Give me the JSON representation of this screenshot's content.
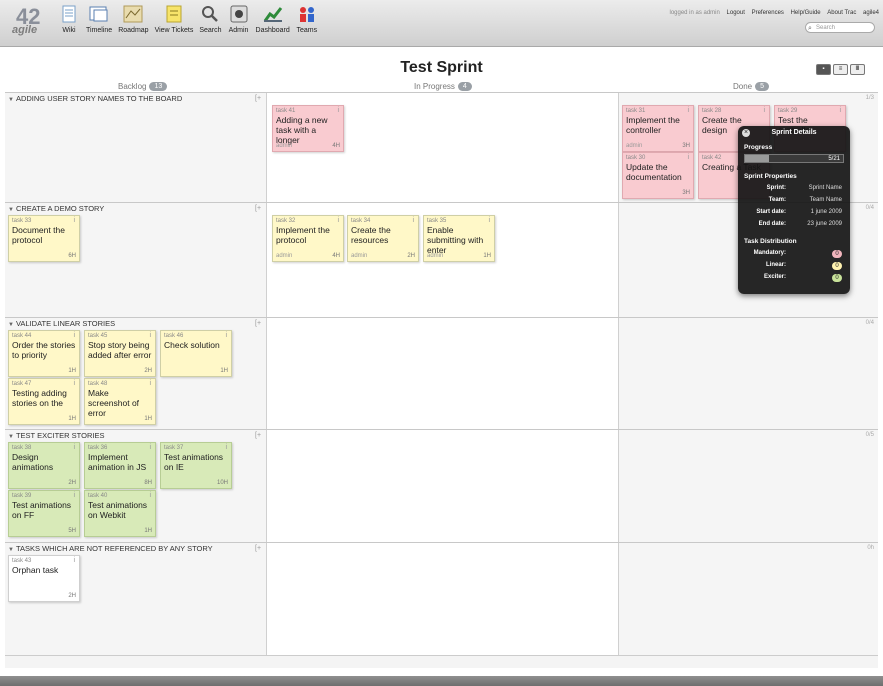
{
  "app": {
    "logo_number": "42",
    "logo_text": "agile"
  },
  "nav": [
    {
      "label": "Wiki",
      "icon": "wiki-icon"
    },
    {
      "label": "Timeline",
      "icon": "timeline-icon"
    },
    {
      "label": "Roadmap",
      "icon": "roadmap-icon"
    },
    {
      "label": "View Tickets",
      "icon": "tickets-icon"
    },
    {
      "label": "Search",
      "icon": "search-icon"
    },
    {
      "label": "Admin",
      "icon": "admin-icon"
    },
    {
      "label": "Dashboard",
      "icon": "dashboard-icon"
    },
    {
      "label": "Teams",
      "icon": "teams-icon"
    }
  ],
  "metanav": {
    "logged_in": "logged in as admin",
    "logout": "Logout",
    "preferences": "Preferences",
    "help": "Help/Guide",
    "about": "About Trac",
    "extra": "agile4"
  },
  "search": {
    "placeholder": "Search"
  },
  "sprint": {
    "title": "Test Sprint"
  },
  "columns": [
    {
      "name": "Backlog",
      "count": "13"
    },
    {
      "name": "In Progress",
      "count": "4"
    },
    {
      "name": "Done",
      "count": "5"
    }
  ],
  "rows": [
    {
      "title": "ADDING USER STORY NAMES TO THE BOARD",
      "count": "1/3",
      "cards": [
        {
          "id": "task 41",
          "title": "Adding a new task with a longer",
          "owner": "admin",
          "est": "4H",
          "color": "pink"
        },
        {
          "id": "task 31",
          "title": "Implement the controller",
          "owner": "admin",
          "est": "3H",
          "color": "pink"
        },
        {
          "id": "task 28",
          "title": "Create the design",
          "owner": "",
          "est": "",
          "color": "pink"
        },
        {
          "id": "task 29",
          "title": "Test the controller",
          "owner": "",
          "est": "",
          "color": "pink"
        },
        {
          "id": "task 30",
          "title": "Update the documentation",
          "owner": "",
          "est": "3H",
          "color": "pink"
        },
        {
          "id": "task 42",
          "title": "Creating a Task",
          "owner": "",
          "est": "",
          "color": "pink"
        }
      ]
    },
    {
      "title": "CREATE A DEMO STORY",
      "count": "0/4",
      "cards": [
        {
          "id": "task 33",
          "title": "Document the protocol",
          "owner": "",
          "est": "6H",
          "color": "yellow"
        },
        {
          "id": "task 32",
          "title": "Implement the protocol",
          "owner": "admin",
          "est": "4H",
          "color": "yellow"
        },
        {
          "id": "task 34",
          "title": "Create the resources",
          "owner": "admin",
          "est": "2H",
          "color": "yellow"
        },
        {
          "id": "task 35",
          "title": "Enable submitting with enter",
          "owner": "admin",
          "est": "1H",
          "color": "yellow"
        }
      ]
    },
    {
      "title": "VALIDATE LINEAR STORIES",
      "count": "0/4",
      "cards": [
        {
          "id": "task 44",
          "title": "Order the stories to priority",
          "owner": "",
          "est": "1H",
          "color": "yellow"
        },
        {
          "id": "task 45",
          "title": "Stop story being added after error",
          "owner": "",
          "est": "2H",
          "color": "yellow"
        },
        {
          "id": "task 46",
          "title": "Check solution",
          "owner": "",
          "est": "1H",
          "color": "yellow"
        },
        {
          "id": "task 47",
          "title": "Testing adding stories on the",
          "owner": "",
          "est": "1H",
          "color": "yellow"
        },
        {
          "id": "task 48",
          "title": "Make screenshot of error",
          "owner": "",
          "est": "1H",
          "color": "yellow"
        }
      ]
    },
    {
      "title": "TEST EXCITER STORIES",
      "count": "0/5",
      "cards": [
        {
          "id": "task 38",
          "title": "Design animations",
          "owner": "",
          "est": "2H",
          "color": "green"
        },
        {
          "id": "task 36",
          "title": "Implement animation in JS",
          "owner": "",
          "est": "8H",
          "color": "green"
        },
        {
          "id": "task 37",
          "title": "Test animations on IE",
          "owner": "",
          "est": "10H",
          "color": "green"
        },
        {
          "id": "task 39",
          "title": "Test animations on FF",
          "owner": "",
          "est": "5H",
          "color": "green"
        },
        {
          "id": "task 40",
          "title": "Test animations on Webkit",
          "owner": "",
          "est": "1H",
          "color": "green"
        }
      ]
    },
    {
      "title": "TASKS WHICH ARE NOT REFERENCED BY ANY STORY",
      "count": "0h",
      "cards": [
        {
          "id": "task 43",
          "title": "Orphan task",
          "owner": "",
          "est": "2H",
          "color": "white"
        }
      ]
    }
  ],
  "sprint_details": {
    "title": "Sprint Details",
    "progress_label": "Progress",
    "progress_text": "5/21",
    "progress_fraction": 0.24,
    "properties_label": "Sprint Properties",
    "sprint_key": "Sprint:",
    "sprint_val": "Sprint Name",
    "team_key": "Team:",
    "team_val": "Team Name",
    "start_key": "Start date:",
    "start_val": "1 june 2009",
    "end_key": "End date:",
    "end_val": "23 june 2009",
    "distribution_label": "Task Distribution",
    "mandatory_key": "Mandatory:",
    "mandatory_val": "0",
    "mandatory_color": "#f2b5bd",
    "linear_key": "Linear:",
    "linear_val": "0",
    "linear_color": "#fff2b0",
    "exciter_key": "Exciter:",
    "exciter_val": "0",
    "exciter_color": "#c9e39a"
  }
}
